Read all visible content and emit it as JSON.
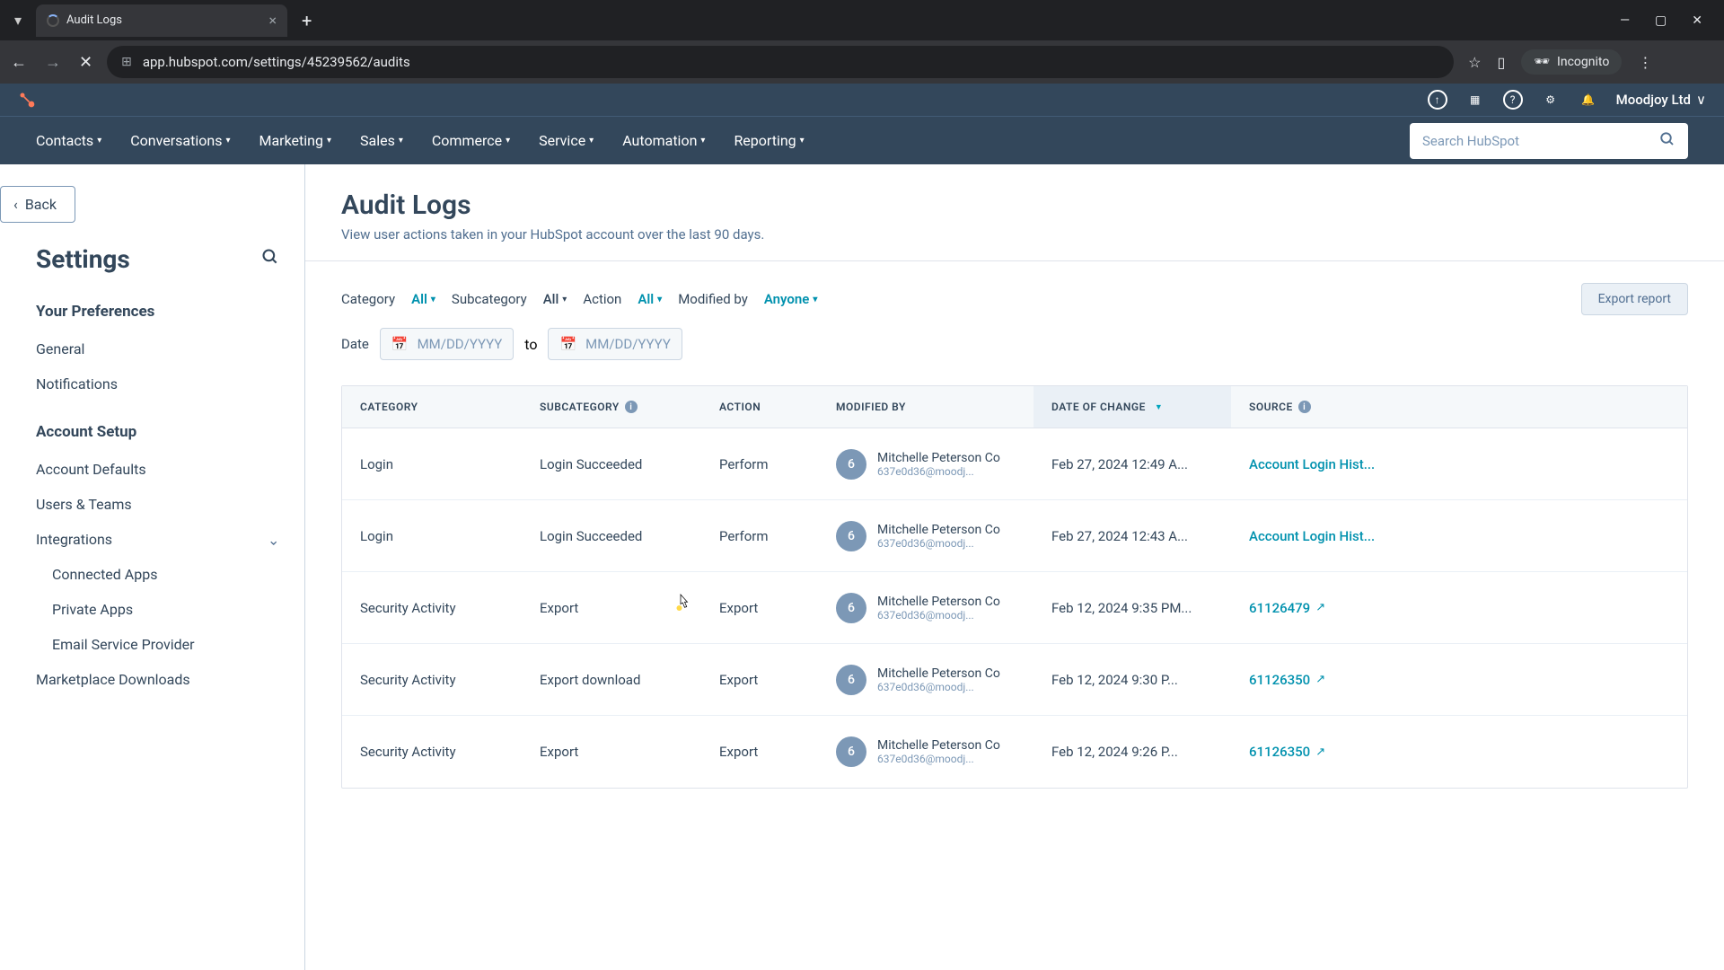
{
  "browser": {
    "tab_title": "Audit Logs",
    "url": "app.hubspot.com/settings/45239562/audits",
    "incognito_label": "Incognito"
  },
  "topbar": {
    "org_name": "Moodjoy Ltd"
  },
  "nav": {
    "items": [
      "Contacts",
      "Conversations",
      "Marketing",
      "Sales",
      "Commerce",
      "Service",
      "Automation",
      "Reporting"
    ],
    "search_placeholder": "Search HubSpot"
  },
  "sidebar": {
    "back_label": "Back",
    "settings_title": "Settings",
    "sections": [
      {
        "header": "Your Preferences",
        "links": [
          {
            "label": "General"
          },
          {
            "label": "Notifications"
          }
        ]
      },
      {
        "header": "Account Setup",
        "links": [
          {
            "label": "Account Defaults"
          },
          {
            "label": "Users & Teams"
          },
          {
            "label": "Integrations",
            "expandable": true
          },
          {
            "label": "Connected Apps",
            "sub": true
          },
          {
            "label": "Private Apps",
            "sub": true
          },
          {
            "label": "Email Service Provider",
            "sub": true
          },
          {
            "label": "Marketplace Downloads"
          }
        ]
      }
    ]
  },
  "page": {
    "title": "Audit Logs",
    "description": "View user actions taken in your HubSpot account over the last 90 days."
  },
  "filters": {
    "category_label": "Category",
    "category_value": "All",
    "subcategory_label": "Subcategory",
    "subcategory_value": "All",
    "action_label": "Action",
    "action_value": "All",
    "modifiedby_label": "Modified by",
    "modifiedby_value": "Anyone",
    "date_label": "Date",
    "date_placeholder": "MM/DD/YYYY",
    "to_label": "to",
    "export_btn": "Export report"
  },
  "table": {
    "columns": {
      "category": "CATEGORY",
      "subcategory": "SUBCATEGORY",
      "action": "ACTION",
      "modifiedby": "MODIFIED BY",
      "date": "DATE OF CHANGE",
      "source": "SOURCE"
    },
    "rows": [
      {
        "category": "Login",
        "subcategory": "Login Succeeded",
        "action": "Perform",
        "user_avatar": "6",
        "user_name": "Mitchelle Peterson Co",
        "user_email": "637e0d36@moodj...",
        "date": "Feb 27, 2024 12:49 A...",
        "source": "Account Login Hist...",
        "external": false
      },
      {
        "category": "Login",
        "subcategory": "Login Succeeded",
        "action": "Perform",
        "user_avatar": "6",
        "user_name": "Mitchelle Peterson Co",
        "user_email": "637e0d36@moodj...",
        "date": "Feb 27, 2024 12:43 A...",
        "source": "Account Login Hist...",
        "external": false
      },
      {
        "category": "Security Activity",
        "subcategory": "Export",
        "action": "Export",
        "user_avatar": "6",
        "user_name": "Mitchelle Peterson Co",
        "user_email": "637e0d36@moodj...",
        "date": "Feb 12, 2024 9:35 PM...",
        "source": "61126479",
        "external": true
      },
      {
        "category": "Security Activity",
        "subcategory": "Export download",
        "action": "Export",
        "user_avatar": "6",
        "user_name": "Mitchelle Peterson Co",
        "user_email": "637e0d36@moodj...",
        "date": "Feb 12, 2024 9:30 P...",
        "source": "61126350",
        "external": true
      },
      {
        "category": "Security Activity",
        "subcategory": "Export",
        "action": "Export",
        "user_avatar": "6",
        "user_name": "Mitchelle Peterson Co",
        "user_email": "637e0d36@moodj...",
        "date": "Feb 12, 2024 9:26 P...",
        "source": "61126350",
        "external": true
      }
    ]
  }
}
